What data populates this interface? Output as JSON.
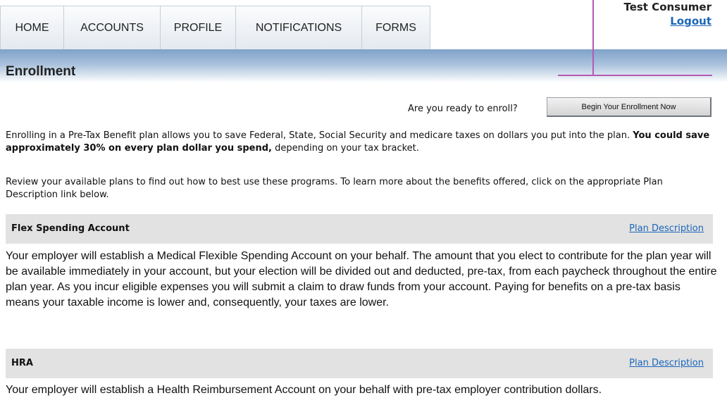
{
  "nav": {
    "tabs": [
      {
        "label": "HOME"
      },
      {
        "label": "ACCOUNTS"
      },
      {
        "label": "PROFILE"
      },
      {
        "label": "NOTIFICATIONS"
      },
      {
        "label": "FORMS"
      }
    ]
  },
  "user": {
    "name": "Test Consumer",
    "logout_label": "Logout"
  },
  "page": {
    "title": "Enrollment"
  },
  "enroll": {
    "prompt": "Are you ready to enroll?",
    "button_label": "Begin Your Enrollment Now"
  },
  "intro": {
    "text_before": "Enrolling in a Pre-Tax Benefit plan allows you to save Federal, State, Social Security and medicare taxes on dollars you put into the plan. ",
    "bold_text": "You could save approximately 30% on every plan dollar you spend,",
    "text_after": " depending on your tax bracket.",
    "review_text": "Review your available plans to find out how to best use these programs. To learn more about the benefits offered, click on the appropriate Plan Description link below."
  },
  "plans": [
    {
      "name": "Flex Spending Account",
      "link_label": "Plan Description",
      "description": "Your employer will establish a Medical Flexible Spending Account on your behalf. The amount that you elect to contribute for the plan year will be available immediately in your account, but your election will be divided out and deducted, pre-tax, from each paycheck throughout the entire plan year. As you incur eligible expenses you will submit a claim to draw funds from your account. Paying for benefits on a pre-tax basis means your taxable income is lower and, consequently, your taxes are lower."
    },
    {
      "name": "HRA",
      "link_label": "Plan Description",
      "description": "Your employer will establish a Health Reimbursement Account on your behalf with pre-tax employer contribution dollars."
    }
  ],
  "colors": {
    "link": "#1a66b8",
    "annotation": "#b45ab4",
    "band": "#7fa2c9",
    "plan_header_bg": "#e2e2e2"
  }
}
